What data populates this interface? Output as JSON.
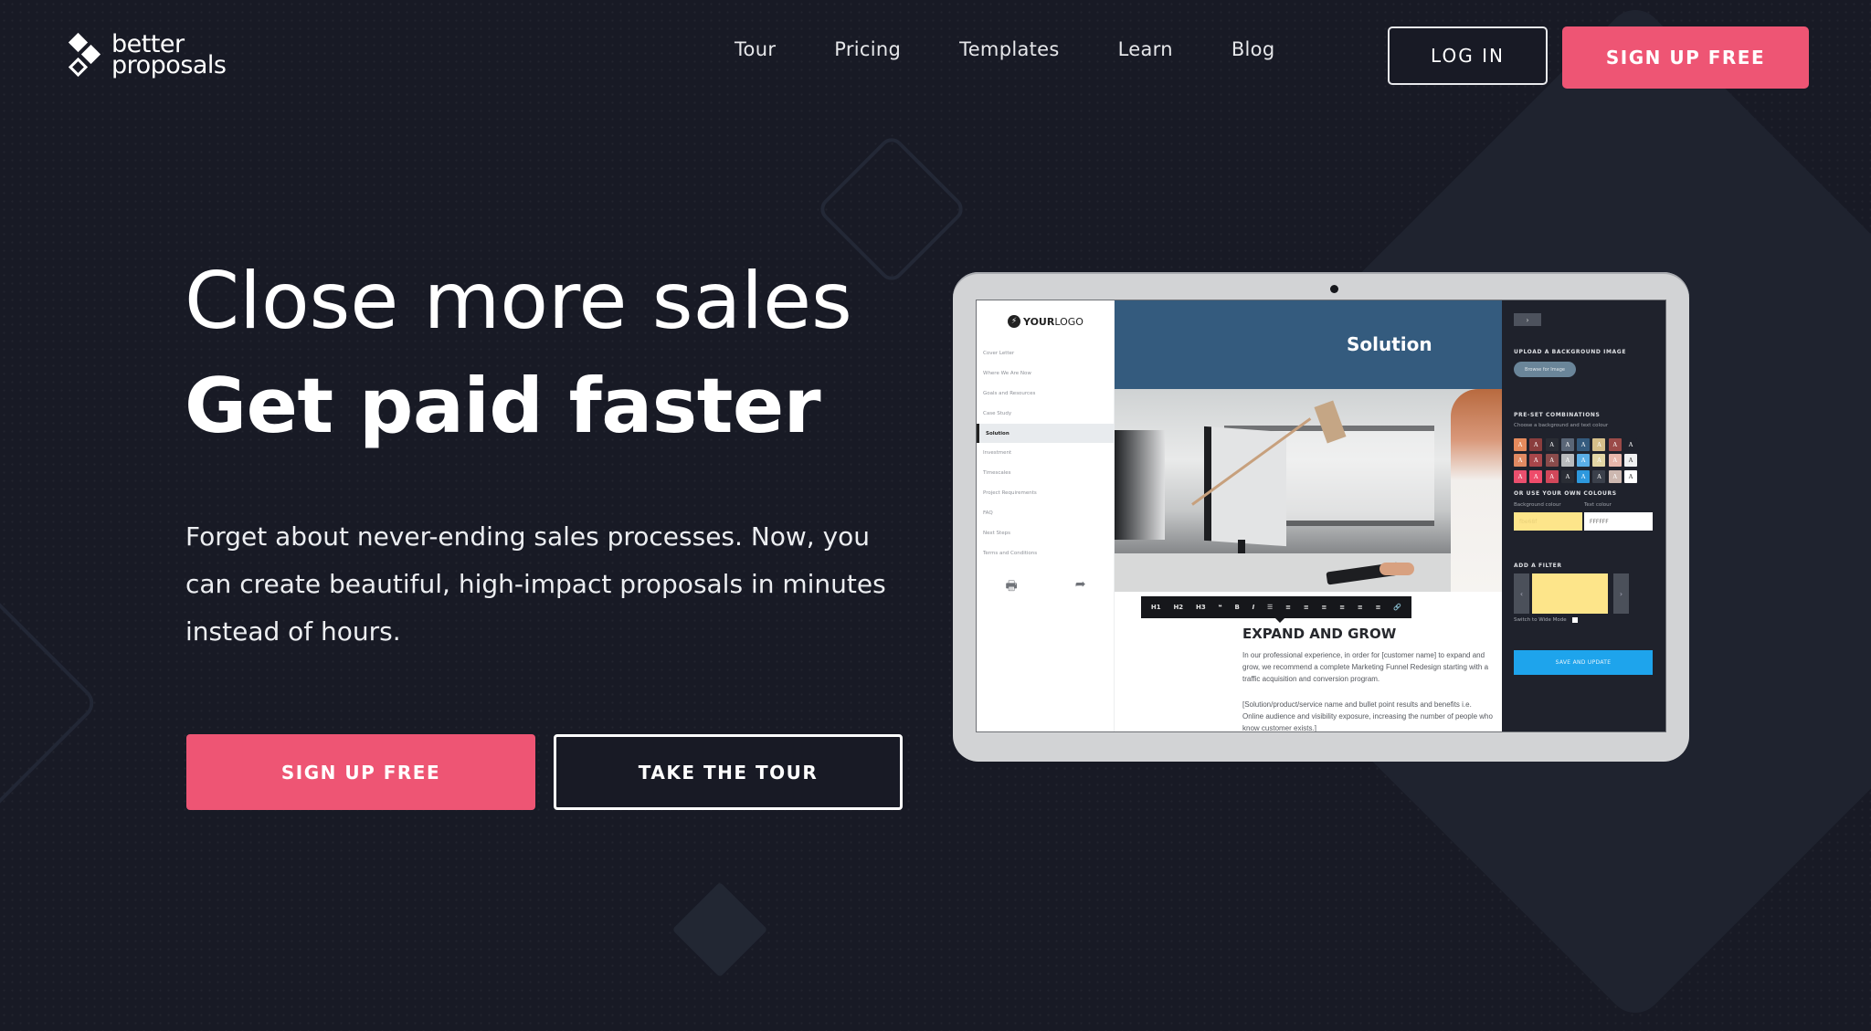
{
  "brand": {
    "name_line1": "better",
    "name_line2": "proposals",
    "accent_color": "#ee5574",
    "background_color": "#181a25"
  },
  "nav": {
    "items": [
      {
        "label": "Tour"
      },
      {
        "label": "Pricing"
      },
      {
        "label": "Templates"
      },
      {
        "label": "Learn"
      },
      {
        "label": "Blog"
      }
    ],
    "login_label": "LOG IN",
    "signup_label": "SIGN UP FREE"
  },
  "hero": {
    "headline_line1": "Close more sales",
    "headline_line2": "Get paid faster",
    "subtext": "Forget about never-ending sales processes. Now, you can create beautiful, high-impact proposals in minutes instead of hours.",
    "primary_cta": "SIGN UP FREE",
    "secondary_cta": "TAKE THE TOUR"
  },
  "preview": {
    "logo_bold": "YOUR",
    "logo_light": "LOGO",
    "sidebar_items": [
      {
        "label": "Cover Letter",
        "active": false
      },
      {
        "label": "Where We Are Now",
        "active": false
      },
      {
        "label": "Goals and Resources",
        "active": false
      },
      {
        "label": "Case Study",
        "active": false
      },
      {
        "label": "Solution",
        "active": true
      },
      {
        "label": "Investment",
        "active": false
      },
      {
        "label": "Timescales",
        "active": false
      },
      {
        "label": "Project Requirements",
        "active": false
      },
      {
        "label": "FAQ",
        "active": false
      },
      {
        "label": "Next Steps",
        "active": false
      },
      {
        "label": "Terms and Conditions",
        "active": false
      }
    ],
    "sidebar_icons": {
      "print": "🖶",
      "share": "➦"
    },
    "section_title": "Solution",
    "section_color": "#345b7e",
    "toolbar": [
      "H1",
      "H2",
      "H3",
      "❝",
      "B",
      "I",
      "☰",
      "≡",
      "≡",
      "≡",
      "≡",
      "≡",
      "≡",
      "🔗"
    ],
    "doc_heading": "EXPAND AND GROW",
    "doc_paragraphs": [
      [
        "In our professional experience, in order for [customer name] to expand and",
        "grow, we recommend a complete Marketing Funnel Redesign starting with a",
        "traffic acquisition and conversion program."
      ],
      [
        "[Solution/product/service name and bullet point results and benefits i.e.",
        "Online audience and visibility exposure, increasing the number of people who",
        "know customer exists.]"
      ]
    ],
    "panel": {
      "toggle_glyph": "›",
      "upload_heading": "UPLOAD A BACKGROUND IMAGE",
      "browse_label": "Browse for Image",
      "preset_heading": "PRE-SET COMBINATIONS",
      "preset_sub": "Choose a background and text colour",
      "swatches": [
        {
          "bg": "#e58a5c",
          "fg": "#ffffff"
        },
        {
          "bg": "#8a3d3d",
          "fg": "#ffffff"
        },
        {
          "bg": "#2a2d35",
          "fg": "#ffffff"
        },
        {
          "bg": "#5a6677",
          "fg": "#ffffff"
        },
        {
          "bg": "#345b7e",
          "fg": "#ffffff"
        },
        {
          "bg": "#d6bf8a",
          "fg": "#ffffff"
        },
        {
          "bg": "#9b4a48",
          "fg": "#ffffff"
        },
        {
          "bg": "#1f222c",
          "fg": "#ffffff"
        },
        {
          "bg": "#e08a62",
          "fg": "#ffffff"
        },
        {
          "bg": "#a8464a",
          "fg": "#ffffff"
        },
        {
          "bg": "#8a4b4b",
          "fg": "#ffffff"
        },
        {
          "bg": "#b8babd",
          "fg": "#ffffff"
        },
        {
          "bg": "#5aaee6",
          "fg": "#ffffff"
        },
        {
          "bg": "#e3d6a5",
          "fg": "#ffffff"
        },
        {
          "bg": "#e8b7ab",
          "fg": "#ffffff"
        },
        {
          "bg": "#f0f1f2",
          "fg": "#333333"
        },
        {
          "bg": "#ea4f6e",
          "fg": "#ffffff"
        },
        {
          "bg": "#ee4b6a",
          "fg": "#ffffff"
        },
        {
          "bg": "#d1475a",
          "fg": "#ffffff"
        },
        {
          "bg": "#2a2d35",
          "fg": "#ffffff"
        },
        {
          "bg": "#2d98dd",
          "fg": "#ffffff"
        },
        {
          "bg": "#3b404b",
          "fg": "#ffffff"
        },
        {
          "bg": "#cdb8b0",
          "fg": "#ffffff"
        },
        {
          "bg": "#ffffff",
          "fg": "#333333"
        }
      ],
      "swatch_glyph": "A",
      "own_heading": "OR USE YOUR OWN COLOURS",
      "bg_colour_label": "Background colour",
      "text_colour_label": "Text colour",
      "bg_colour_value": "fbe68f",
      "text_colour_value": "FFFFFF",
      "bg_colour_swatch": "#fde58a",
      "filter_heading": "ADD A FILTER",
      "filter_prev": "‹",
      "filter_next": "›",
      "wide_mode_label": "Switch to Wide Mode",
      "save_label": "SAVE AND UPDATE"
    }
  }
}
